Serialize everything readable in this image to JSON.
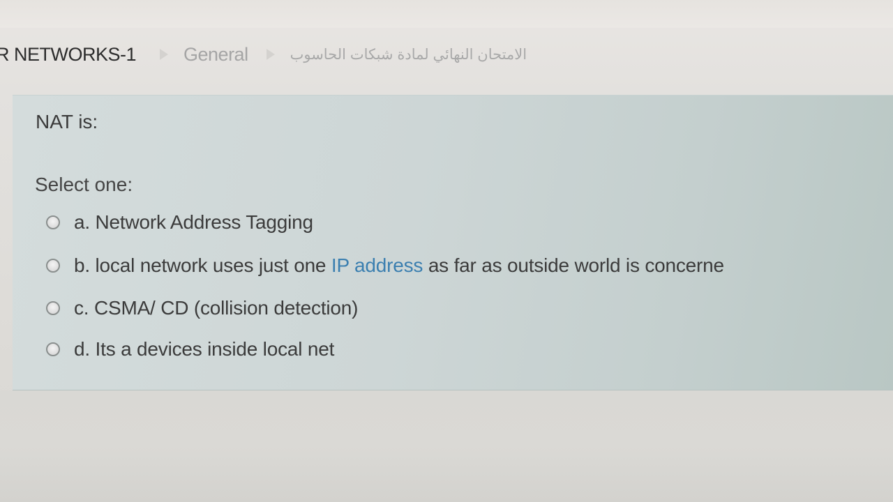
{
  "breadcrumb": {
    "course": "R NETWORKS-1",
    "section": "General",
    "quiz": "الامتحان النهائي لمادة شبكات الحاسوب"
  },
  "question": {
    "text": "NAT is:",
    "prompt": "Select one:",
    "answers": [
      {
        "label": "a. Network Address Tagging"
      },
      {
        "label_before": "b. local network uses just one ",
        "label_link": "IP address",
        "label_after": " as far as outside world is concerne"
      },
      {
        "label": "c. CSMA/ CD (collision detection)"
      },
      {
        "label": "d. Its a devices inside local net"
      }
    ]
  },
  "colors": {
    "panel": "#cdd6d6",
    "link": "#3b7fb0",
    "text": "#3b3b3b"
  }
}
